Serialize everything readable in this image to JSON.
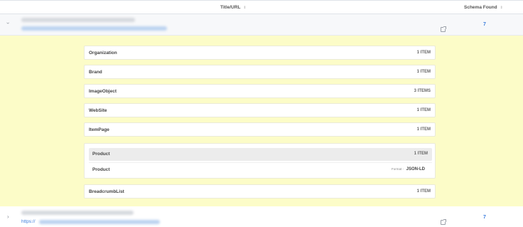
{
  "header": {
    "title_col": "Title/URL",
    "schema_col": "Schema Found",
    "sort_icon": "sort-icon"
  },
  "rows": [
    {
      "schema_count": "7",
      "expanded": true
    },
    {
      "url_prefix": "https://",
      "schema_count": "7",
      "expanded": false
    }
  ],
  "schemas": [
    {
      "name": "Organization",
      "items": "1 ITEM"
    },
    {
      "name": "Brand",
      "items": "1 ITEM"
    },
    {
      "name": "ImageObject",
      "items": "3 ITEMS"
    },
    {
      "name": "WebSite",
      "items": "1 ITEM"
    },
    {
      "name": "ItemPage",
      "items": "1 ITEM"
    }
  ],
  "product": {
    "name": "Product",
    "items": "1 ITEM",
    "sub_name": "Product",
    "format_label": "Format -",
    "format_value": "JSON-LD"
  },
  "breadcrumb": {
    "name": "BreadcrumbList",
    "items": "1 ITEM"
  },
  "colors": {
    "expanded_bg": "#fcfcc8",
    "link": "#3b7ddd",
    "header_border": "#dfe3e8"
  }
}
